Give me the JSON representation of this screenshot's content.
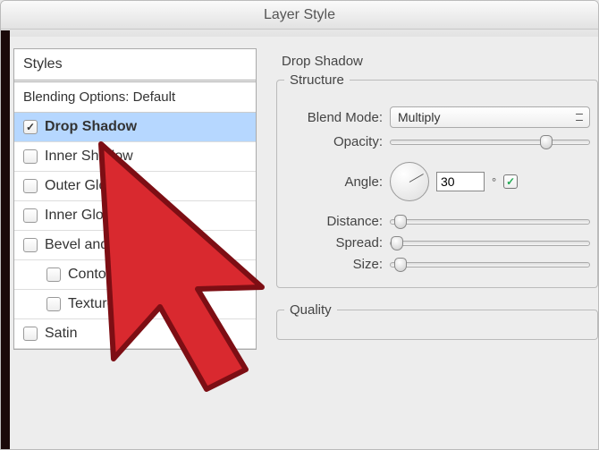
{
  "window": {
    "title": "Layer Style"
  },
  "styles_panel": {
    "header": "Styles",
    "subheader": "Blending Options: Default",
    "items": [
      {
        "label": "Drop Shadow",
        "checked": true,
        "selected": true,
        "indent": false
      },
      {
        "label": "Inner Shadow",
        "checked": false,
        "selected": false,
        "indent": false
      },
      {
        "label": "Outer Glow",
        "checked": false,
        "selected": false,
        "indent": false
      },
      {
        "label": "Inner Glow",
        "checked": false,
        "selected": false,
        "indent": false
      },
      {
        "label": "Bevel and Emboss",
        "checked": false,
        "selected": false,
        "indent": false
      },
      {
        "label": "Contour",
        "checked": false,
        "selected": false,
        "indent": true
      },
      {
        "label": "Texture",
        "checked": false,
        "selected": false,
        "indent": true
      },
      {
        "label": "Satin",
        "checked": false,
        "selected": false,
        "indent": false
      }
    ]
  },
  "right": {
    "section_title": "Drop Shadow",
    "structure": {
      "legend": "Structure",
      "blend_mode_label": "Blend Mode:",
      "blend_mode_value": "Multiply",
      "opacity_label": "Opacity:",
      "opacity_pct": 75,
      "angle_label": "Angle:",
      "angle_value": "30",
      "angle_unit": "°",
      "use_global_light_checked": true,
      "distance_label": "Distance:",
      "spread_label": "Spread:",
      "size_label": "Size:"
    },
    "quality": {
      "legend": "Quality"
    }
  }
}
